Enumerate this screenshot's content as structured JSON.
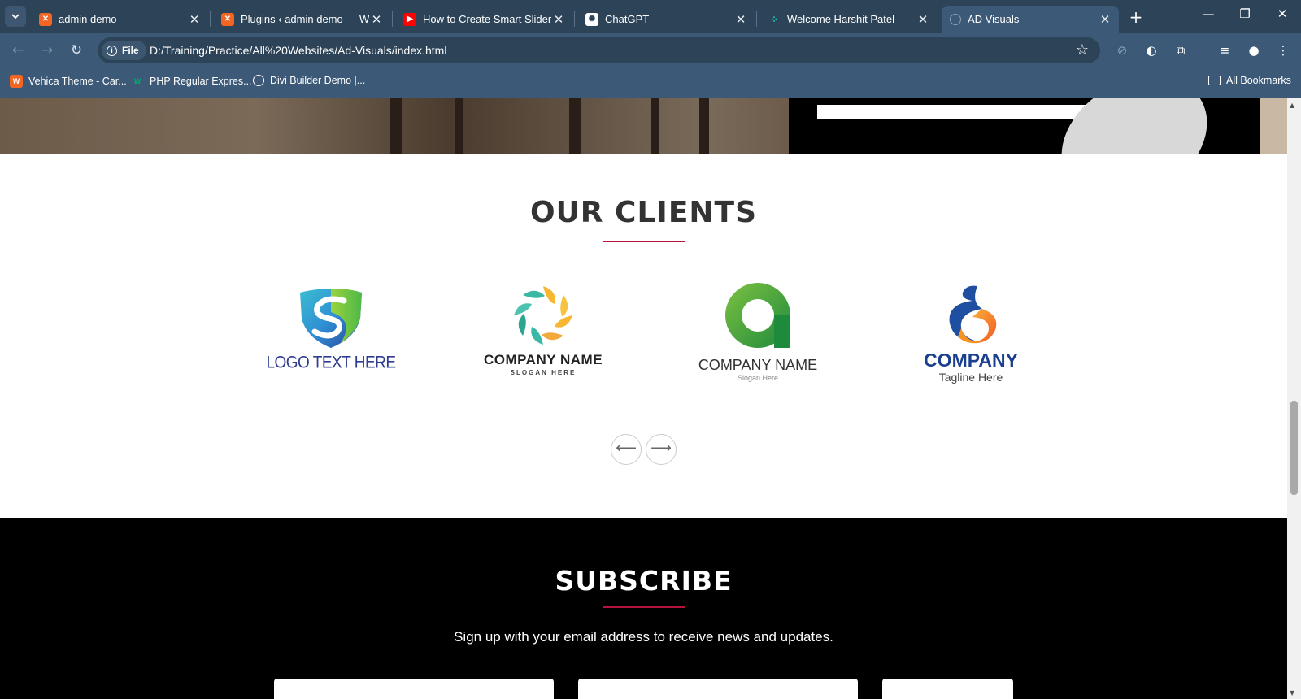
{
  "browser": {
    "tabs": [
      {
        "title": "admin demo",
        "favicon": "xampp-icon",
        "color": "#f26522",
        "active": false
      },
      {
        "title": "Plugins ‹ admin demo — Wo",
        "favicon": "xampp-icon",
        "color": "#f26522",
        "active": false
      },
      {
        "title": "How to Create Smart Slider i",
        "favicon": "youtube-icon",
        "color": "#ff0000",
        "active": false
      },
      {
        "title": "ChatGPT",
        "favicon": "chatgpt-icon",
        "color": "#ffffff",
        "active": false
      },
      {
        "title": "Welcome Harshit Patel",
        "favicon": "grid-dots-icon",
        "color": "#2ec4b6",
        "active": false
      },
      {
        "title": "AD Visuals",
        "favicon": "globe-icon",
        "color": "#8aa3b9",
        "active": true
      }
    ],
    "address": {
      "chip_label": "File",
      "url": "D:/Training/Practice/All%20Websites/Ad-Visuals/index.html"
    },
    "bookmarks": [
      {
        "label": "Vehica Theme - Car...",
        "icon": "wp-icon"
      },
      {
        "label": "PHP Regular Expres...",
        "icon": "w3-icon"
      },
      {
        "label": "Divi Builder Demo |...",
        "icon": "globe-icon"
      }
    ],
    "all_bookmarks_label": "All Bookmarks"
  },
  "clients": {
    "title": "OUR CLIENTS",
    "accent": "#b5123e",
    "logos": [
      {
        "name": "shield-s-logo",
        "text": "LOGO TEXT HERE",
        "tagline": ""
      },
      {
        "name": "petal-wheel-logo",
        "text": "COMPANY NAME",
        "tagline": "SLOGAN HERE"
      },
      {
        "name": "green-ring-logo",
        "text": "COMPANY NAME",
        "tagline": "Slogan Here"
      },
      {
        "name": "swan-s-logo",
        "text": "COMPANY",
        "tagline": "Tagline Here"
      }
    ],
    "prev_label": "⟵",
    "next_label": "⟶"
  },
  "subscribe": {
    "title": "SUBSCRIBE",
    "text": "Sign up with your email address to receive news and updates."
  }
}
